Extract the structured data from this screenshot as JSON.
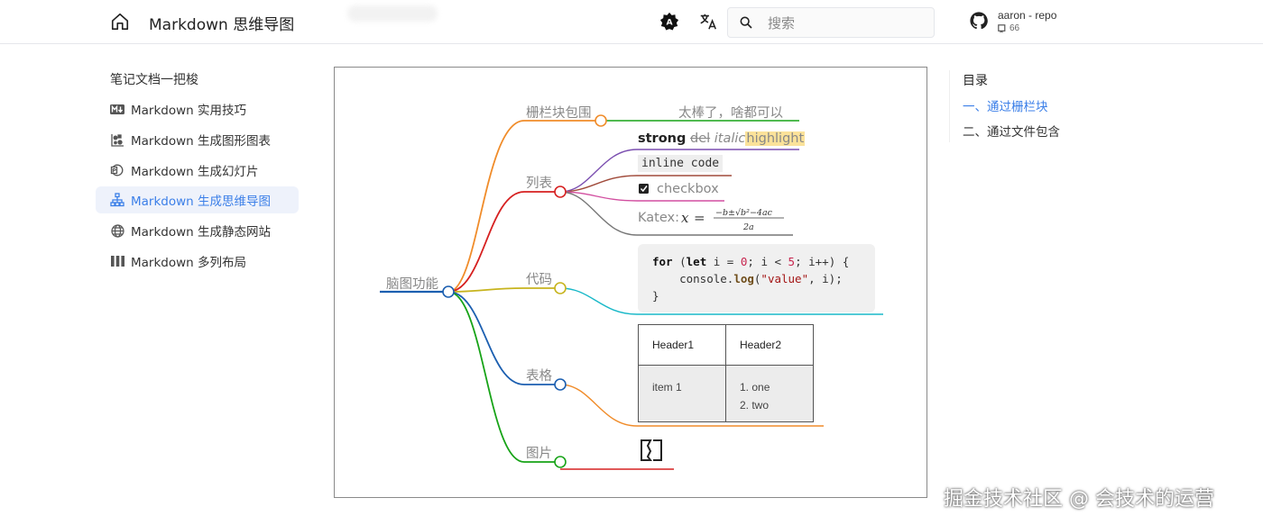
{
  "header": {
    "title": "Markdown 思维导图",
    "search_placeholder": "搜索",
    "repo_name": "aaron - repo",
    "repo_stars": "66"
  },
  "sidebar": {
    "title": "笔记文档一把梭",
    "items": [
      {
        "label": "Markdown 实用技巧",
        "icon": "markdown-icon",
        "active": false
      },
      {
        "label": "Markdown 生成图形图表",
        "icon": "chart-shapes-icon",
        "active": false
      },
      {
        "label": "Markdown 生成幻灯片",
        "icon": "slides-icon",
        "active": false
      },
      {
        "label": "Markdown 生成思维导图",
        "icon": "sitemap-icon",
        "active": true
      },
      {
        "label": "Markdown 生成静态网站",
        "icon": "globe-icon",
        "active": false
      },
      {
        "label": "Markdown 多列布局",
        "icon": "columns-icon",
        "active": false
      }
    ]
  },
  "mindmap": {
    "root": "脑图功能",
    "branches": {
      "fence": "栅栏块包围",
      "list": "列表",
      "code": "代码",
      "table": "表格",
      "image": "图片"
    },
    "fence_leaf": "太棒了，啥都可以",
    "list_leaves": {
      "strong": "strong",
      "del": "del",
      "italic": "italic",
      "highlight": "highlight",
      "inline_code": "inline code",
      "checkbox": "checkbox",
      "katex_label": "Katex:"
    },
    "code_lines": [
      "for (let i = 0; i < 5; i++) {",
      "    console.log(\"value\", i);",
      "}"
    ],
    "table": {
      "headers": [
        "Header1",
        "Header2"
      ],
      "row": [
        "item 1",
        "1. one",
        "2. two"
      ]
    }
  },
  "toc": {
    "title": "目录",
    "items": [
      {
        "label": "一、通过栅栏块",
        "active": true
      },
      {
        "label": "二、通过文件包含",
        "active": false
      }
    ]
  },
  "watermark": "掘金技术社区 @ 会技术的运营",
  "colors": {
    "accent": "#3b7fe8",
    "active_bg": "#eef2fb",
    "branch_fence": "#f08c2a",
    "branch_list": "#d62020",
    "branch_code": "#c7b41e",
    "branch_table": "#1c5fb0",
    "branch_image": "#17a317"
  }
}
